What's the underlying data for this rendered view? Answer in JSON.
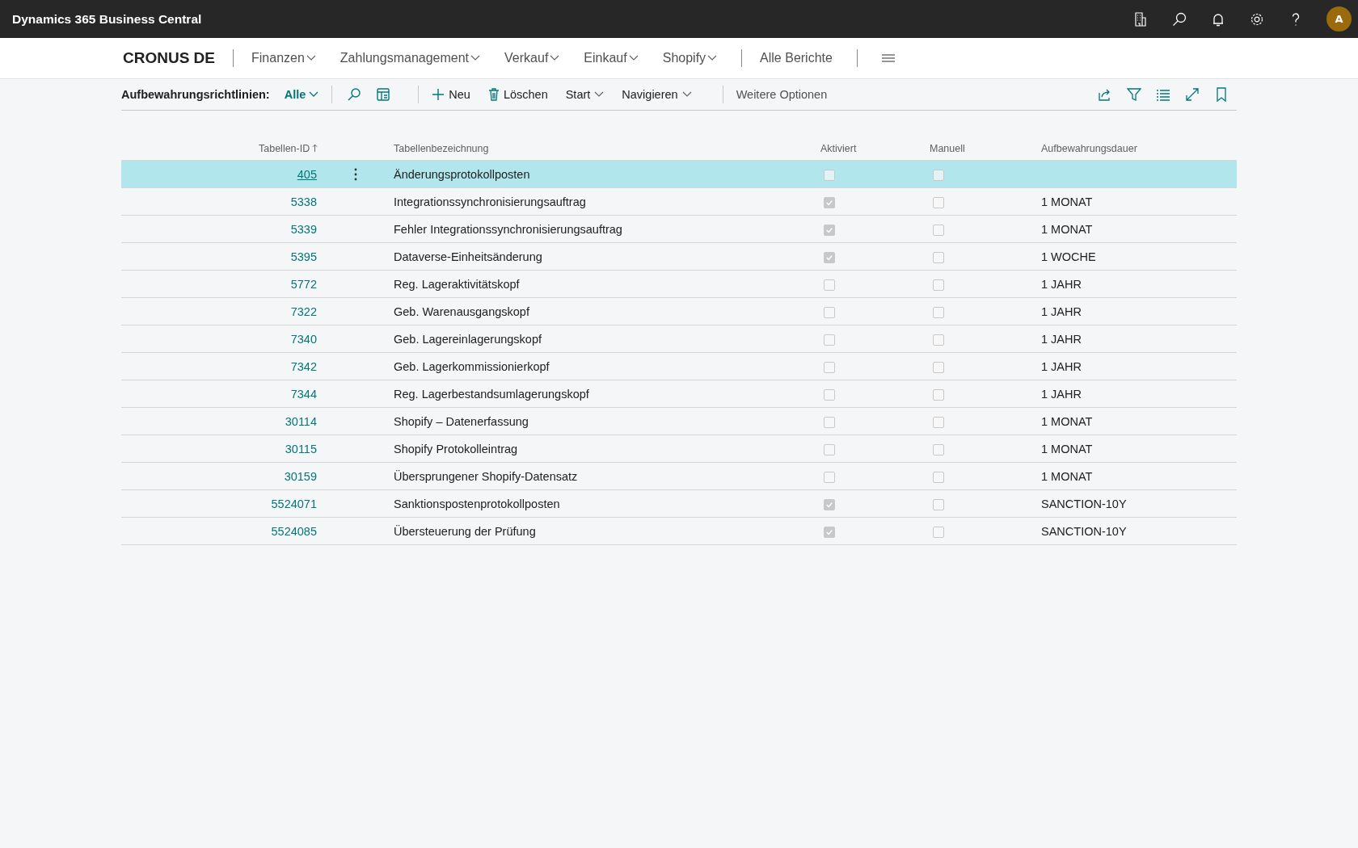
{
  "app_bar": {
    "title": "Dynamics 365 Business Central",
    "avatar": "A"
  },
  "nav": {
    "company": "CRONUS DE",
    "menus": [
      {
        "label": "Finanzen"
      },
      {
        "label": "Zahlungsmanagement"
      },
      {
        "label": "Verkauf"
      },
      {
        "label": "Einkauf"
      },
      {
        "label": "Shopify"
      }
    ],
    "reports": "Alle Berichte"
  },
  "toolbar": {
    "page_label": "Aufbewahrungsrichtlinien:",
    "view": "Alle",
    "new": "Neu",
    "delete": "Löschen",
    "menus": [
      "Start",
      "Navigieren"
    ],
    "more": "Weitere Optionen"
  },
  "table": {
    "columns": [
      {
        "label": "Tabellen-ID",
        "sorted": true
      },
      {
        "label": "Tabellenbezeichnung",
        "sorted": false
      },
      {
        "label": "Aktiviert",
        "sorted": false
      },
      {
        "label": "Manuell",
        "sorted": false
      },
      {
        "label": "Aufbewahrungsdauer",
        "sorted": false
      }
    ],
    "rows": [
      {
        "id": "405",
        "name": "Änderungsprotokollposten",
        "enabled": false,
        "manual": false,
        "period": "",
        "selected": true
      },
      {
        "id": "5338",
        "name": "Integrationssynchronisierungsauftrag",
        "enabled": true,
        "manual": false,
        "period": "1 MONAT",
        "selected": false
      },
      {
        "id": "5339",
        "name": "Fehler Integrationssynchronisierungsauftrag",
        "enabled": true,
        "manual": false,
        "period": "1 MONAT",
        "selected": false
      },
      {
        "id": "5395",
        "name": "Dataverse-Einheitsänderung",
        "enabled": true,
        "manual": false,
        "period": "1 WOCHE",
        "selected": false
      },
      {
        "id": "5772",
        "name": "Reg. Lageraktivitätskopf",
        "enabled": false,
        "manual": false,
        "period": "1 JAHR",
        "selected": false
      },
      {
        "id": "7322",
        "name": "Geb. Warenausgangskopf",
        "enabled": false,
        "manual": false,
        "period": "1 JAHR",
        "selected": false
      },
      {
        "id": "7340",
        "name": "Geb. Lagereinlagerungskopf",
        "enabled": false,
        "manual": false,
        "period": "1 JAHR",
        "selected": false
      },
      {
        "id": "7342",
        "name": "Geb. Lagerkommissionierkopf",
        "enabled": false,
        "manual": false,
        "period": "1 JAHR",
        "selected": false
      },
      {
        "id": "7344",
        "name": "Reg. Lagerbestandsumlagerungskopf",
        "enabled": false,
        "manual": false,
        "period": "1 JAHR",
        "selected": false
      },
      {
        "id": "30114",
        "name": "Shopify – Datenerfassung",
        "enabled": false,
        "manual": false,
        "period": "1 MONAT",
        "selected": false
      },
      {
        "id": "30115",
        "name": "Shopify Protokolleintrag",
        "enabled": false,
        "manual": false,
        "period": "1 MONAT",
        "selected": false
      },
      {
        "id": "30159",
        "name": "Übersprungener Shopify-Datensatz",
        "enabled": false,
        "manual": false,
        "period": "1 MONAT",
        "selected": false
      },
      {
        "id": "5524071",
        "name": "Sanktionspostenprotokollposten",
        "enabled": true,
        "manual": false,
        "period": "SANCTION-10Y",
        "selected": false
      },
      {
        "id": "5524085",
        "name": "Übersteuerung der Prüfung",
        "enabled": true,
        "manual": false,
        "period": "SANCTION-10Y",
        "selected": false
      }
    ]
  }
}
